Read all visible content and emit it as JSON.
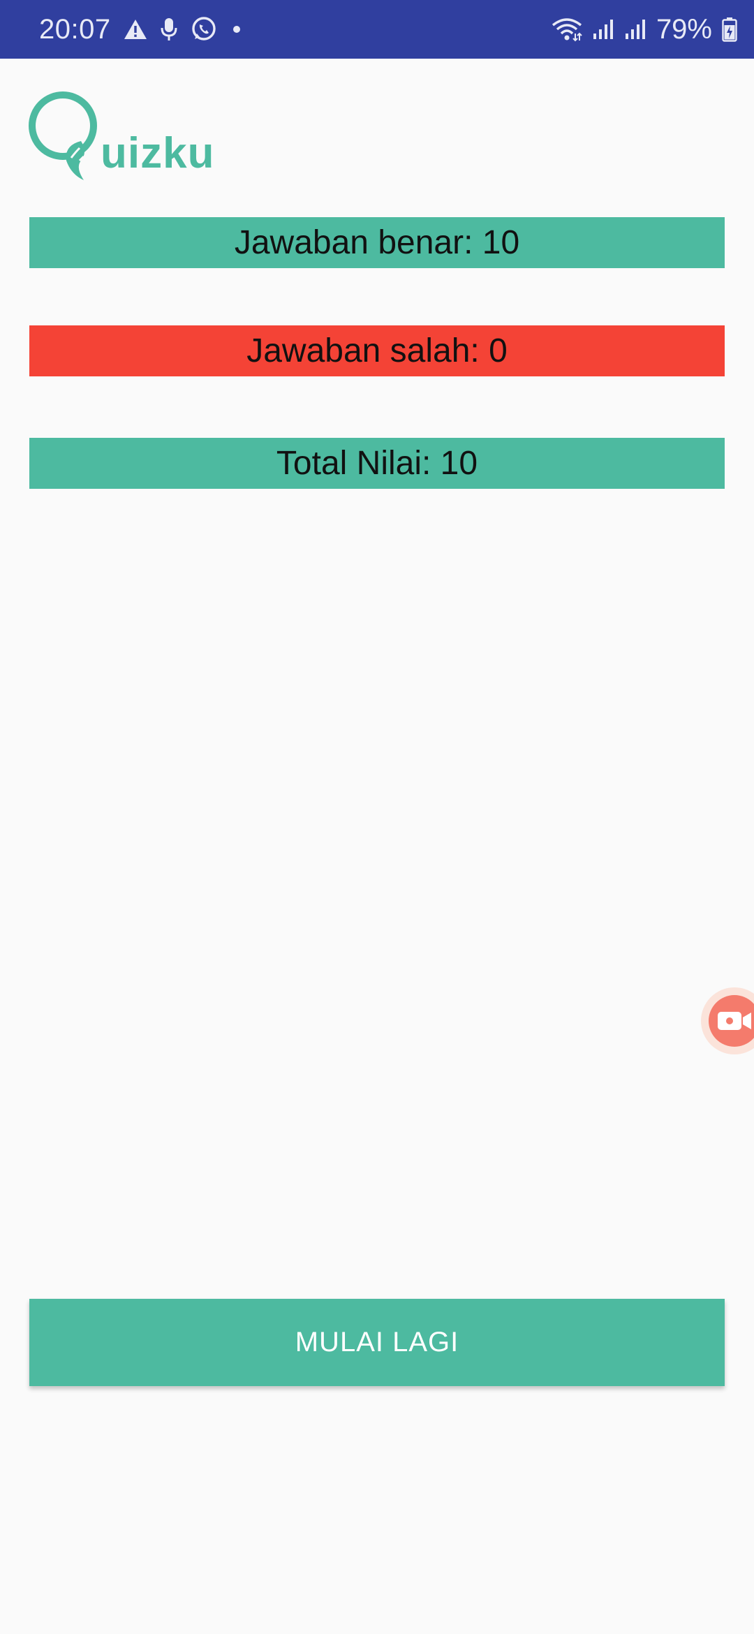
{
  "status_bar": {
    "time": "20:07",
    "battery": "79%",
    "left_icons": [
      "warning-icon",
      "microphone-icon",
      "whatsapp-icon",
      "dot-icon"
    ],
    "right_icons": [
      "wifi-icon",
      "signal-icon",
      "signal-icon",
      "battery-charging-icon"
    ],
    "bg_color": "#303f9f"
  },
  "logo": {
    "text": "uizku",
    "icon": "q-leaf-logo",
    "color": "#4dbaa0"
  },
  "results": {
    "correct_label": "Jawaban benar: 10",
    "wrong_label": "Jawaban salah: 0",
    "total_label": "Total Nilai: 10",
    "correct_color": "#4dbaa0",
    "wrong_color": "#f44336"
  },
  "restart_button": {
    "label": "MULAI LAGI"
  },
  "floating": {
    "icon": "video-record-icon",
    "color": "#f47b6c"
  }
}
